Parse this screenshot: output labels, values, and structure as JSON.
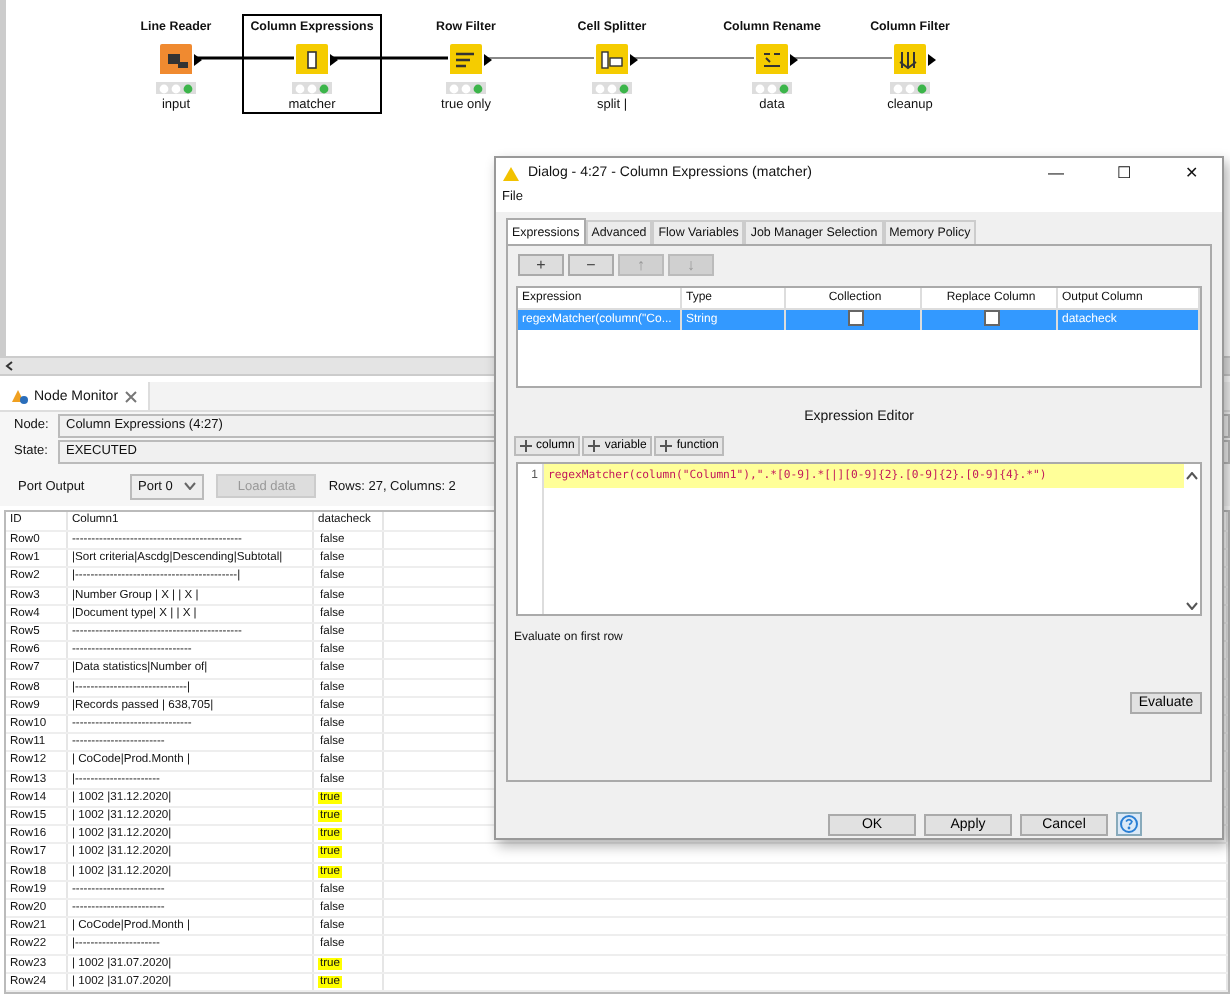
{
  "workflow": {
    "nodes": [
      {
        "name": "Line Reader",
        "label": "input",
        "color": "#f08a30",
        "selected": false
      },
      {
        "name": "Column Expressions",
        "label": "matcher",
        "color": "#f5cc00",
        "selected": true
      },
      {
        "name": "Row Filter",
        "label": "true only",
        "color": "#f5cc00",
        "selected": false
      },
      {
        "name": "Cell Splitter",
        "label": "split |",
        "color": "#f5cc00",
        "selected": false
      },
      {
        "name": "Column Rename",
        "label": "data",
        "color": "#f5cc00",
        "selected": false
      },
      {
        "name": "Column Filter",
        "label": "cleanup",
        "color": "#f5cc00",
        "selected": false
      }
    ]
  },
  "node_monitor": {
    "title": "Node Monitor",
    "node_label": "Node:",
    "node_value": "Column Expressions  (4:27)",
    "state_label": "State:",
    "state_value": "EXECUTED",
    "port_label": "Port Output",
    "port_value": "Port 0",
    "load_button": "Load data",
    "summary": "Rows: 27, Columns: 2",
    "table": {
      "columns": [
        "ID",
        "Column1",
        "datacheck"
      ],
      "rows": [
        {
          "id": "Row0",
          "column1": "--------------------------------------------",
          "datacheck": "false",
          "highlighted": false
        },
        {
          "id": "Row1",
          "column1": "|Sort criteria|Ascdg|Descending|Subtotal|",
          "datacheck": "false",
          "highlighted": false
        },
        {
          "id": "Row2",
          "column1": "|------------------------------------------|",
          "datacheck": "false",
          "highlighted": false
        },
        {
          "id": "Row3",
          "column1": "|Number Group |  X  |        |  X  |",
          "datacheck": "false",
          "highlighted": false
        },
        {
          "id": "Row4",
          "column1": "|Document type|  X  |        |  X  |",
          "datacheck": "false",
          "highlighted": false
        },
        {
          "id": "Row5",
          "column1": "--------------------------------------------",
          "datacheck": "false",
          "highlighted": false
        },
        {
          "id": "Row6",
          "column1": "-------------------------------",
          "datacheck": "false",
          "highlighted": false
        },
        {
          "id": "Row7",
          "column1": "|Data statistics|Number of|",
          "datacheck": "false",
          "highlighted": false
        },
        {
          "id": "Row8",
          "column1": "|-----------------------------|",
          "datacheck": "false",
          "highlighted": false
        },
        {
          "id": "Row9",
          "column1": "|Records passed |  638,705|",
          "datacheck": "false",
          "highlighted": false
        },
        {
          "id": "Row10",
          "column1": "-------------------------------",
          "datacheck": "false",
          "highlighted": false
        },
        {
          "id": "Row11",
          "column1": "------------------------",
          "datacheck": "false",
          "highlighted": false
        },
        {
          "id": "Row12",
          "column1": "|  CoCode|Prod.Month |",
          "datacheck": "false",
          "highlighted": false
        },
        {
          "id": "Row13",
          "column1": "|----------------------",
          "datacheck": "false",
          "highlighted": false
        },
        {
          "id": "Row14",
          "column1": "|  1002  |31.12.2020|",
          "datacheck": "true",
          "highlighted": true
        },
        {
          "id": "Row15",
          "column1": "|  1002  |31.12.2020|",
          "datacheck": "true",
          "highlighted": true
        },
        {
          "id": "Row16",
          "column1": "|  1002  |31.12.2020|",
          "datacheck": "true",
          "highlighted": true
        },
        {
          "id": "Row17",
          "column1": "|  1002  |31.12.2020|",
          "datacheck": "true",
          "highlighted": true
        },
        {
          "id": "Row18",
          "column1": "|  1002  |31.12.2020|",
          "datacheck": "true",
          "highlighted": true
        },
        {
          "id": "Row19",
          "column1": "------------------------",
          "datacheck": "false",
          "highlighted": false
        },
        {
          "id": "Row20",
          "column1": "------------------------",
          "datacheck": "false",
          "highlighted": false
        },
        {
          "id": "Row21",
          "column1": "|  CoCode|Prod.Month |",
          "datacheck": "false",
          "highlighted": false
        },
        {
          "id": "Row22",
          "column1": "|----------------------",
          "datacheck": "false",
          "highlighted": false
        },
        {
          "id": "Row23",
          "column1": "|  1002  |31.07.2020|",
          "datacheck": "true",
          "highlighted": true
        },
        {
          "id": "Row24",
          "column1": "|  1002  |31.07.2020|",
          "datacheck": "true",
          "highlighted": true
        }
      ]
    }
  },
  "dialog": {
    "title": "Dialog - 4:27 - Column Expressions (matcher)",
    "controls": [
      "—",
      "☐",
      "✕"
    ],
    "menu": [
      "File"
    ],
    "tabs": [
      {
        "label": "Expressions",
        "selected": true
      },
      {
        "label": "Advanced",
        "selected": false
      },
      {
        "label": "Flow Variables",
        "selected": false
      },
      {
        "label": "Job Manager Selection",
        "selected": false
      },
      {
        "label": "Memory Policy",
        "selected": false
      }
    ],
    "toolbar": [
      {
        "label": "+",
        "disabled": false
      },
      {
        "label": "−",
        "disabled": false
      },
      {
        "label": "↑",
        "disabled": true
      },
      {
        "label": "↓",
        "disabled": true
      }
    ],
    "expressions": {
      "columns": [
        "Expression",
        "Type",
        "Collection",
        "Replace Column",
        "Output Column"
      ],
      "rows": [
        {
          "expression": "regexMatcher(column(\"Co...",
          "type": "String",
          "collection": false,
          "replace_column": false,
          "output_column": "datacheck",
          "selected": true
        }
      ]
    },
    "editor_title": "Expression Editor",
    "insert_buttons": [
      "column",
      "variable",
      "function"
    ],
    "code_line_number": "1",
    "code": "regexMatcher(column(\"Column1\"),\".*[0-9].*[|][0-9]{2}.[0-9]{2}.[0-9]{4}.*\")",
    "evaluate_label": "Evaluate on first row",
    "evaluate_button": "Evaluate",
    "buttons": [
      "OK",
      "Apply",
      "Cancel"
    ]
  }
}
